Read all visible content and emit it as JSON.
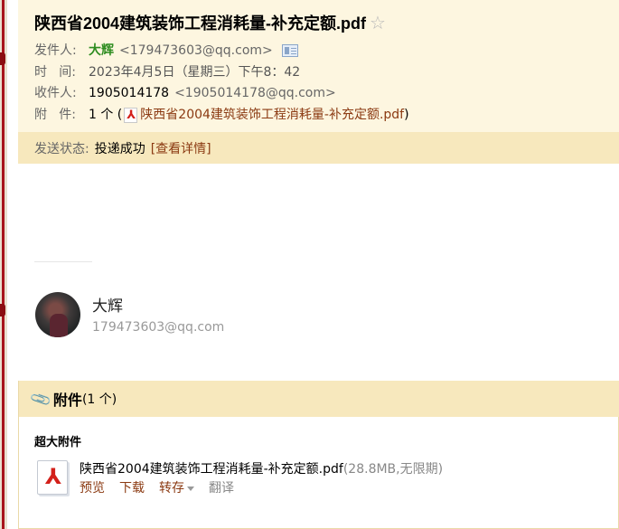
{
  "header": {
    "subject": "陕西省2004建筑装饰工程消耗量-补充定额.pdf",
    "sender": {
      "label_chars": [
        "发件人:"
      ],
      "label": "发件人:",
      "name": "大辉",
      "email": "<179473603@qq.com>"
    },
    "time": {
      "label_a": "时",
      "label_b": "间:",
      "value": "2023年4月5日（星期三）下午8：42"
    },
    "recipient": {
      "label": "收件人:",
      "name": "1905014178",
      "email": "<1905014178@qq.com>"
    },
    "attachment": {
      "label_a": "附",
      "label_b": "件:",
      "count": "1 个 (",
      "file": "陕西省2004建筑装饰工程消耗量-补充定额.pdf",
      "close": ")"
    }
  },
  "status": {
    "label": "发送状态:",
    "value": "投递成功",
    "link": "[查看详情]"
  },
  "signature": {
    "name": "大辉",
    "email": "179473603@qq.com"
  },
  "attachments_section": {
    "title": "附件",
    "count": "(1 个)",
    "big_label": "超大附件",
    "file": {
      "name": "陕西省2004建筑装饰工程消耗量-补充定额.pdf",
      "info": "(28.8MB,无限期)"
    },
    "actions": {
      "preview": "预览",
      "download": "下载",
      "save": "转存",
      "translate": "翻译"
    }
  }
}
